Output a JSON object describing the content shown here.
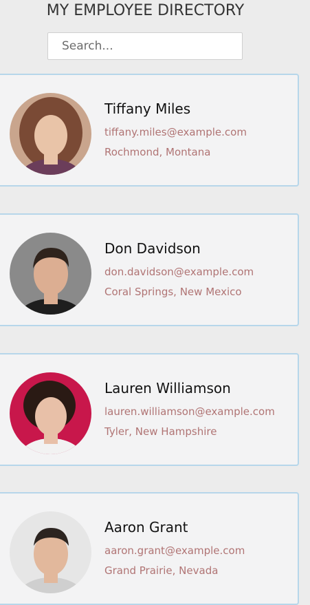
{
  "header": {
    "title": "MY EMPLOYEE DIRECTORY"
  },
  "search": {
    "placeholder": "Search...",
    "value": ""
  },
  "employees": [
    {
      "name": "Tiffany Miles",
      "email": "tiffany.miles@example.com",
      "location": "Rochmond, Montana",
      "avatar_colors": {
        "bg": "#c9a58d",
        "hair": "#7a4a35",
        "skin": "#e9c4a8",
        "shirt": "#6b3d5a"
      }
    },
    {
      "name": "Don Davidson",
      "email": "don.davidson@example.com",
      "location": "Coral Springs, New Mexico",
      "avatar_colors": {
        "bg": "#8a8a8a",
        "hair": "#2f231c",
        "skin": "#dcae92",
        "shirt": "#1e1e1e"
      }
    },
    {
      "name": "Lauren Williamson",
      "email": "lauren.williamson@example.com",
      "location": "Tyler, New Hampshire",
      "avatar_colors": {
        "bg": "#c8174b",
        "hair": "#2a1a14",
        "skin": "#e8c0a8",
        "shirt": "#f2f2f2"
      }
    },
    {
      "name": "Aaron Grant",
      "email": "aaron.grant@example.com",
      "location": "Grand Prairie, Nevada",
      "avatar_colors": {
        "bg": "#e6e6e6",
        "hair": "#2c2420",
        "skin": "#e2b89c",
        "shirt": "#cfcfcf"
      }
    }
  ]
}
